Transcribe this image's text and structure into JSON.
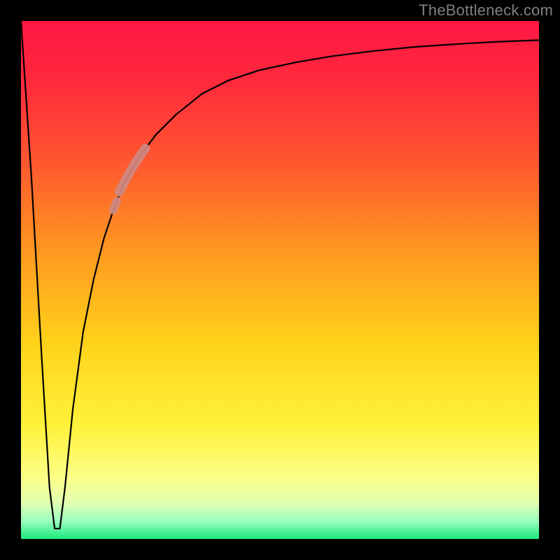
{
  "watermark": "TheBottleneck.com",
  "colors": {
    "frame": "#000000",
    "watermark": "#808080",
    "curve": "#000000",
    "highlight": "#cf8981",
    "gradient_stops": [
      {
        "offset": 0.0,
        "color": "#ff1744"
      },
      {
        "offset": 0.12,
        "color": "#ff2a3c"
      },
      {
        "offset": 0.28,
        "color": "#ff5a2f"
      },
      {
        "offset": 0.45,
        "color": "#ff9a1f"
      },
      {
        "offset": 0.62,
        "color": "#ffd21a"
      },
      {
        "offset": 0.78,
        "color": "#fff23a"
      },
      {
        "offset": 0.88,
        "color": "#fcff86"
      },
      {
        "offset": 0.93,
        "color": "#e2ffb0"
      },
      {
        "offset": 0.965,
        "color": "#9dffc0"
      },
      {
        "offset": 1.0,
        "color": "#18e87b"
      }
    ]
  },
  "chart_data": {
    "type": "line",
    "title": "",
    "xlabel": "",
    "ylabel": "",
    "xlim": [
      0,
      100
    ],
    "ylim": [
      0,
      100
    ],
    "grid": false,
    "series": [
      {
        "name": "bottleneck-curve",
        "x": [
          0,
          2,
          4,
          5.5,
          6.5,
          7.5,
          8.5,
          10,
          12,
          14,
          16,
          18,
          20,
          23,
          26,
          30,
          35,
          40,
          46,
          53,
          60,
          68,
          76,
          85,
          92,
          100
        ],
        "y": [
          100,
          70,
          35,
          10,
          2,
          2,
          10,
          25,
          40,
          50,
          58,
          64,
          69,
          74,
          78,
          82,
          86,
          88.5,
          90.5,
          92,
          93.2,
          94.2,
          95,
          95.6,
          96,
          96.3
        ]
      }
    ],
    "highlight_segments": [
      {
        "name": "upper-segment",
        "x": [
          19,
          20,
          21,
          22,
          23,
          24
        ],
        "y": [
          67,
          69,
          70.8,
          72.5,
          74,
          75.4
        ]
      },
      {
        "name": "lower-dot",
        "x": [
          17.8,
          18.5
        ],
        "y": [
          63.5,
          65.2
        ]
      }
    ]
  }
}
